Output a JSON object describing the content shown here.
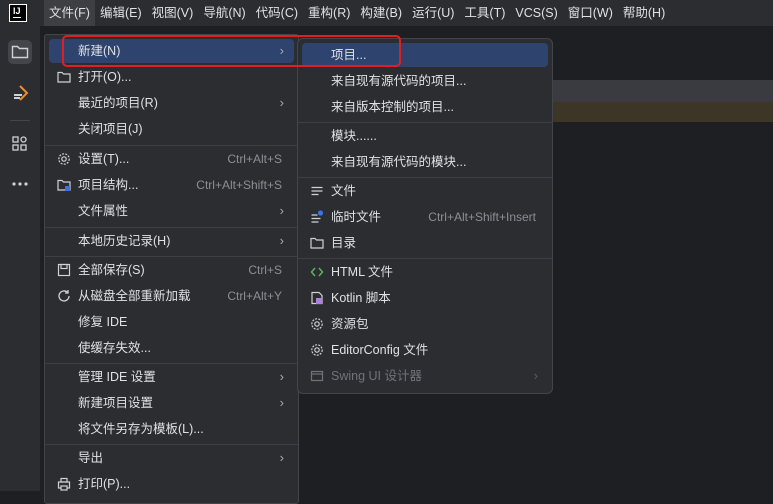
{
  "menubar": {
    "logo_text": "IJ",
    "items": [
      "文件(F)",
      "编辑(E)",
      "视图(V)",
      "导航(N)",
      "代码(C)",
      "重构(R)",
      "构建(B)",
      "运行(U)",
      "工具(T)",
      "VCS(S)",
      "窗口(W)",
      "帮助(H)"
    ]
  },
  "toolstrip": {
    "icons": [
      "project-folder-icon",
      "learn-icon",
      "structure-icon",
      "more-icon"
    ]
  },
  "file_menu": {
    "items": [
      {
        "label": "新建(N)",
        "shortcut": "",
        "submenu": true
      },
      {
        "label": "打开(O)...",
        "shortcut": "",
        "submenu": false
      },
      {
        "label": "最近的项目(R)",
        "shortcut": "",
        "submenu": true
      },
      {
        "label": "关闭项目(J)",
        "shortcut": "",
        "submenu": false
      },
      {
        "label": "设置(T)...",
        "shortcut": "Ctrl+Alt+S",
        "submenu": false
      },
      {
        "label": "项目结构...",
        "shortcut": "Ctrl+Alt+Shift+S",
        "submenu": false
      },
      {
        "label": "文件属性",
        "shortcut": "",
        "submenu": true
      },
      {
        "label": "本地历史记录(H)",
        "shortcut": "",
        "submenu": true
      },
      {
        "label": "全部保存(S)",
        "shortcut": "Ctrl+S",
        "submenu": false
      },
      {
        "label": "从磁盘全部重新加载",
        "shortcut": "Ctrl+Alt+Y",
        "submenu": false
      },
      {
        "label": "修复 IDE",
        "shortcut": "",
        "submenu": false
      },
      {
        "label": "使缓存失效...",
        "shortcut": "",
        "submenu": false
      },
      {
        "label": "管理 IDE 设置",
        "shortcut": "",
        "submenu": true
      },
      {
        "label": "新建项目设置",
        "shortcut": "",
        "submenu": true
      },
      {
        "label": "将文件另存为模板(L)...",
        "shortcut": "",
        "submenu": false
      },
      {
        "label": "导出",
        "shortcut": "",
        "submenu": true
      },
      {
        "label": "打印(P)...",
        "shortcut": "",
        "submenu": false
      }
    ]
  },
  "new_submenu": {
    "items": [
      {
        "label": "项目...",
        "shortcut": "",
        "submenu": false
      },
      {
        "label": "来自现有源代码的项目...",
        "shortcut": "",
        "submenu": false
      },
      {
        "label": "来自版本控制的项目...",
        "shortcut": "",
        "submenu": false
      },
      {
        "label": "模块......",
        "shortcut": "",
        "submenu": false
      },
      {
        "label": "来自现有源代码的模块...",
        "shortcut": "",
        "submenu": false
      },
      {
        "label": "文件",
        "shortcut": "",
        "submenu": false
      },
      {
        "label": "临时文件",
        "shortcut": "Ctrl+Alt+Shift+Insert",
        "submenu": false
      },
      {
        "label": "目录",
        "shortcut": "",
        "submenu": false
      },
      {
        "label": "HTML 文件",
        "shortcut": "",
        "submenu": false
      },
      {
        "label": "Kotlin 脚本",
        "shortcut": "",
        "submenu": false
      },
      {
        "label": "资源包",
        "shortcut": "",
        "submenu": false
      },
      {
        "label": "EditorConfig 文件",
        "shortcut": "",
        "submenu": false
      },
      {
        "label": "Swing UI 设计器",
        "shortcut": "",
        "submenu": true
      }
    ]
  },
  "colors": {
    "menu_bg": "#2b2d30",
    "highlight": "#2e436e",
    "focus_outline": "#e02020",
    "text": "#dfe1e5",
    "shortcut": "#8c8f94"
  }
}
